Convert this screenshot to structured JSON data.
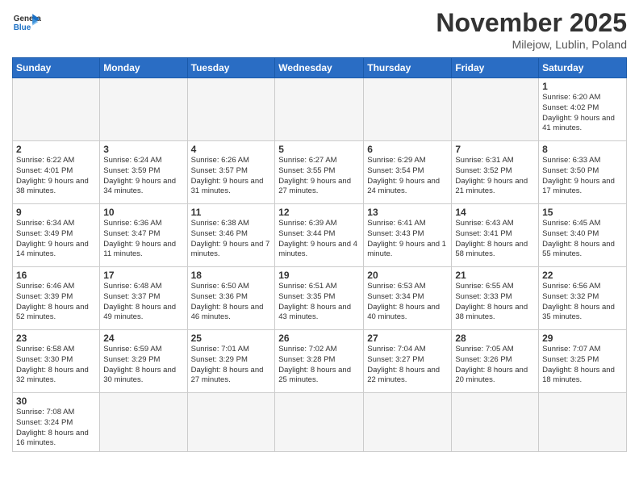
{
  "header": {
    "logo_general": "General",
    "logo_blue": "Blue",
    "month_title": "November 2025",
    "location": "Milejow, Lublin, Poland"
  },
  "weekdays": [
    "Sunday",
    "Monday",
    "Tuesday",
    "Wednesday",
    "Thursday",
    "Friday",
    "Saturday"
  ],
  "weeks": [
    [
      {
        "day": "",
        "info": ""
      },
      {
        "day": "",
        "info": ""
      },
      {
        "day": "",
        "info": ""
      },
      {
        "day": "",
        "info": ""
      },
      {
        "day": "",
        "info": ""
      },
      {
        "day": "",
        "info": ""
      },
      {
        "day": "1",
        "info": "Sunrise: 6:20 AM\nSunset: 4:02 PM\nDaylight: 9 hours and 41 minutes."
      }
    ],
    [
      {
        "day": "2",
        "info": "Sunrise: 6:22 AM\nSunset: 4:01 PM\nDaylight: 9 hours and 38 minutes."
      },
      {
        "day": "3",
        "info": "Sunrise: 6:24 AM\nSunset: 3:59 PM\nDaylight: 9 hours and 34 minutes."
      },
      {
        "day": "4",
        "info": "Sunrise: 6:26 AM\nSunset: 3:57 PM\nDaylight: 9 hours and 31 minutes."
      },
      {
        "day": "5",
        "info": "Sunrise: 6:27 AM\nSunset: 3:55 PM\nDaylight: 9 hours and 27 minutes."
      },
      {
        "day": "6",
        "info": "Sunrise: 6:29 AM\nSunset: 3:54 PM\nDaylight: 9 hours and 24 minutes."
      },
      {
        "day": "7",
        "info": "Sunrise: 6:31 AM\nSunset: 3:52 PM\nDaylight: 9 hours and 21 minutes."
      },
      {
        "day": "8",
        "info": "Sunrise: 6:33 AM\nSunset: 3:50 PM\nDaylight: 9 hours and 17 minutes."
      }
    ],
    [
      {
        "day": "9",
        "info": "Sunrise: 6:34 AM\nSunset: 3:49 PM\nDaylight: 9 hours and 14 minutes."
      },
      {
        "day": "10",
        "info": "Sunrise: 6:36 AM\nSunset: 3:47 PM\nDaylight: 9 hours and 11 minutes."
      },
      {
        "day": "11",
        "info": "Sunrise: 6:38 AM\nSunset: 3:46 PM\nDaylight: 9 hours and 7 minutes."
      },
      {
        "day": "12",
        "info": "Sunrise: 6:39 AM\nSunset: 3:44 PM\nDaylight: 9 hours and 4 minutes."
      },
      {
        "day": "13",
        "info": "Sunrise: 6:41 AM\nSunset: 3:43 PM\nDaylight: 9 hours and 1 minute."
      },
      {
        "day": "14",
        "info": "Sunrise: 6:43 AM\nSunset: 3:41 PM\nDaylight: 8 hours and 58 minutes."
      },
      {
        "day": "15",
        "info": "Sunrise: 6:45 AM\nSunset: 3:40 PM\nDaylight: 8 hours and 55 minutes."
      }
    ],
    [
      {
        "day": "16",
        "info": "Sunrise: 6:46 AM\nSunset: 3:39 PM\nDaylight: 8 hours and 52 minutes."
      },
      {
        "day": "17",
        "info": "Sunrise: 6:48 AM\nSunset: 3:37 PM\nDaylight: 8 hours and 49 minutes."
      },
      {
        "day": "18",
        "info": "Sunrise: 6:50 AM\nSunset: 3:36 PM\nDaylight: 8 hours and 46 minutes."
      },
      {
        "day": "19",
        "info": "Sunrise: 6:51 AM\nSunset: 3:35 PM\nDaylight: 8 hours and 43 minutes."
      },
      {
        "day": "20",
        "info": "Sunrise: 6:53 AM\nSunset: 3:34 PM\nDaylight: 8 hours and 40 minutes."
      },
      {
        "day": "21",
        "info": "Sunrise: 6:55 AM\nSunset: 3:33 PM\nDaylight: 8 hours and 38 minutes."
      },
      {
        "day": "22",
        "info": "Sunrise: 6:56 AM\nSunset: 3:32 PM\nDaylight: 8 hours and 35 minutes."
      }
    ],
    [
      {
        "day": "23",
        "info": "Sunrise: 6:58 AM\nSunset: 3:30 PM\nDaylight: 8 hours and 32 minutes."
      },
      {
        "day": "24",
        "info": "Sunrise: 6:59 AM\nSunset: 3:29 PM\nDaylight: 8 hours and 30 minutes."
      },
      {
        "day": "25",
        "info": "Sunrise: 7:01 AM\nSunset: 3:29 PM\nDaylight: 8 hours and 27 minutes."
      },
      {
        "day": "26",
        "info": "Sunrise: 7:02 AM\nSunset: 3:28 PM\nDaylight: 8 hours and 25 minutes."
      },
      {
        "day": "27",
        "info": "Sunrise: 7:04 AM\nSunset: 3:27 PM\nDaylight: 8 hours and 22 minutes."
      },
      {
        "day": "28",
        "info": "Sunrise: 7:05 AM\nSunset: 3:26 PM\nDaylight: 8 hours and 20 minutes."
      },
      {
        "day": "29",
        "info": "Sunrise: 7:07 AM\nSunset: 3:25 PM\nDaylight: 8 hours and 18 minutes."
      }
    ],
    [
      {
        "day": "30",
        "info": "Sunrise: 7:08 AM\nSunset: 3:24 PM\nDaylight: 8 hours and 16 minutes."
      },
      {
        "day": "",
        "info": ""
      },
      {
        "day": "",
        "info": ""
      },
      {
        "day": "",
        "info": ""
      },
      {
        "day": "",
        "info": ""
      },
      {
        "day": "",
        "info": ""
      },
      {
        "day": "",
        "info": ""
      }
    ]
  ]
}
